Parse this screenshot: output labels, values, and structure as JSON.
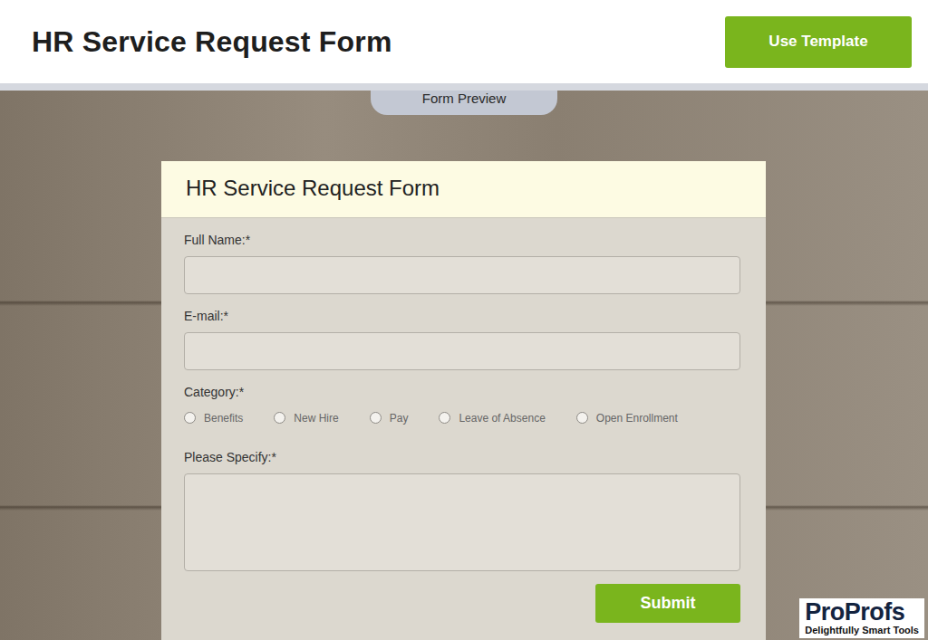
{
  "header": {
    "title": "HR Service Request Form",
    "button": "Use Template"
  },
  "preview_tab": {
    "label": "Form Preview"
  },
  "form": {
    "title": "HR Service Request Form",
    "fields": [
      {
        "label": "Full Name:*",
        "kind": "text"
      },
      {
        "label": "E-mail:*",
        "kind": "text"
      },
      {
        "label": "Category:*",
        "kind": "radio",
        "options": [
          {
            "label": "Benefits",
            "selected": false
          },
          {
            "label": "New Hire",
            "selected": false
          },
          {
            "label": "Pay",
            "selected": false
          },
          {
            "label": "Leave of Absence",
            "selected": false
          },
          {
            "label": "Open Enrollment",
            "selected": false
          }
        ]
      },
      {
        "label": "Please Specify:*",
        "kind": "textarea"
      }
    ],
    "submit": "Submit"
  },
  "logo": {
    "name": "ProProfs",
    "tagline": "Delightfully Smart Tools"
  }
}
